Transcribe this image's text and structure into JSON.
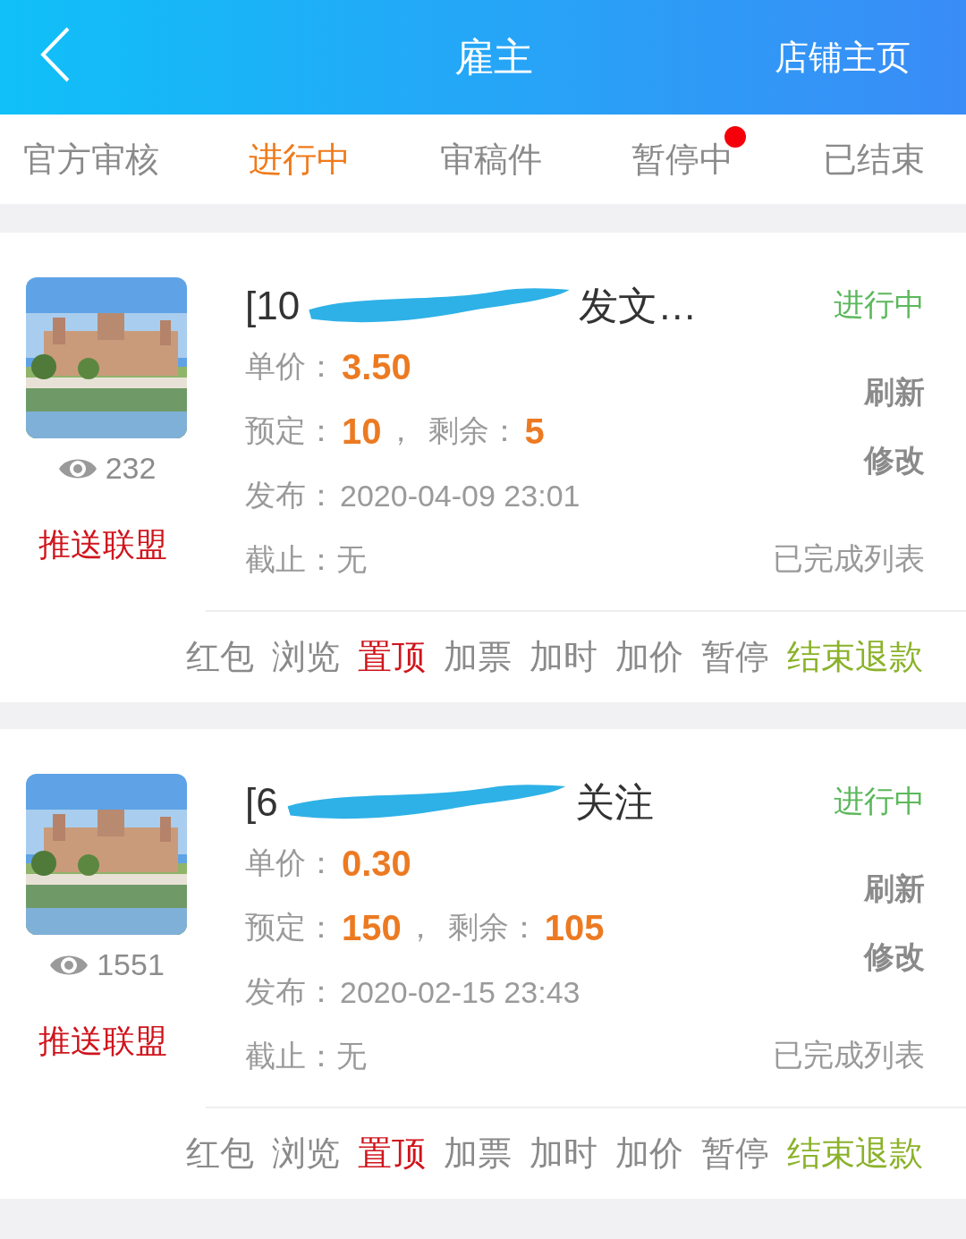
{
  "header": {
    "title": "雇主",
    "action": "店铺主页"
  },
  "tabs": [
    {
      "label": "官方审核",
      "selected": false,
      "badge": false
    },
    {
      "label": "进行中",
      "selected": true,
      "badge": false
    },
    {
      "label": "审稿件",
      "selected": false,
      "badge": false
    },
    {
      "label": "暂停中",
      "selected": false,
      "badge": true
    },
    {
      "label": "已结束",
      "selected": false,
      "badge": false
    }
  ],
  "tasks": [
    {
      "title_start": "[10",
      "title_end": "发文…",
      "views": "232",
      "push": "推送联盟",
      "status": "进行中",
      "price_label": "单价：",
      "price": "3.50",
      "booked_label": "预定：",
      "booked": "10",
      "sep": "，",
      "remain_label": "剩余：",
      "remain": "5",
      "published_label": "发布：",
      "published": "2020-04-09 23:01",
      "deadline_label": "截止：",
      "deadline": "无",
      "side_actions": [
        "刷新",
        "修改"
      ],
      "done_list": "已完成列表",
      "actions": [
        {
          "label": "红包",
          "kind": "plain"
        },
        {
          "label": "浏览",
          "kind": "plain"
        },
        {
          "label": "置顶",
          "kind": "hot"
        },
        {
          "label": "加票",
          "kind": "plain"
        },
        {
          "label": "加时",
          "kind": "plain"
        },
        {
          "label": "加价",
          "kind": "plain"
        },
        {
          "label": "暂停",
          "kind": "plain"
        },
        {
          "label": "结束退款",
          "kind": "end"
        }
      ]
    },
    {
      "title_start": "[6",
      "title_end": "关注",
      "views": "1551",
      "push": "推送联盟",
      "status": "进行中",
      "price_label": "单价：",
      "price": "0.30",
      "booked_label": "预定：",
      "booked": "150",
      "sep": "，",
      "remain_label": "剩余：",
      "remain": "105",
      "published_label": "发布：",
      "published": "2020-02-15 23:43",
      "deadline_label": "截止：",
      "deadline": "无",
      "side_actions": [
        "刷新",
        "修改"
      ],
      "done_list": "已完成列表",
      "actions": [
        {
          "label": "红包",
          "kind": "plain"
        },
        {
          "label": "浏览",
          "kind": "plain"
        },
        {
          "label": "置顶",
          "kind": "hot"
        },
        {
          "label": "加票",
          "kind": "plain"
        },
        {
          "label": "加时",
          "kind": "plain"
        },
        {
          "label": "加价",
          "kind": "plain"
        },
        {
          "label": "暂停",
          "kind": "plain"
        },
        {
          "label": "结束退款",
          "kind": "end"
        }
      ]
    }
  ]
}
